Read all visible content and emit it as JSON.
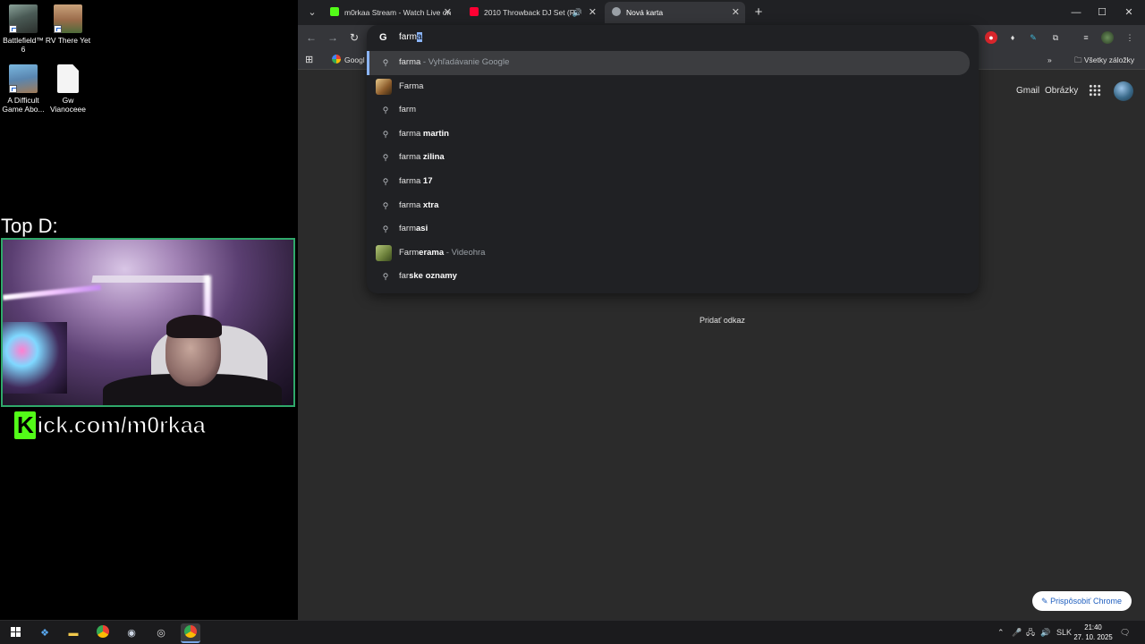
{
  "desktop": {
    "icons": [
      {
        "label": "Battlefield™ 6"
      },
      {
        "label": "RV There Yet"
      },
      {
        "label": "A Difficult Game Abo..."
      },
      {
        "label": "Gw Vianoceee"
      }
    ],
    "overlay_title": "Top D:",
    "kick_k": "K",
    "kick_text": "ick.com/m0rkaa"
  },
  "tabs": [
    {
      "title": "m0rkaa Stream - Watch Live on",
      "favicon_color": "#53fc18"
    },
    {
      "title": "2010 Throwback DJ Set (Ri",
      "favicon_color": "#ff0033"
    },
    {
      "title": "Nová karta",
      "active": true
    }
  ],
  "omnibox": {
    "typed": "farm",
    "autocompleted": "a",
    "suggestions": [
      {
        "typed": "farma",
        "bold": "",
        "desc": " - Vyhľadávanie Google",
        "icon": "search-icon"
      },
      {
        "typed": "Farma",
        "bold": "",
        "desc": "",
        "icon": "image-thumbnail"
      },
      {
        "typed": "farm",
        "bold": "",
        "desc": "",
        "icon": "search-icon"
      },
      {
        "typed": "farma",
        "bold": " martin",
        "desc": "",
        "icon": "search-icon"
      },
      {
        "typed": "farma",
        "bold": " zilina",
        "desc": "",
        "icon": "search-icon"
      },
      {
        "typed": "farma",
        "bold": " 17",
        "desc": "",
        "icon": "search-icon"
      },
      {
        "typed": "farma",
        "bold": " xtra",
        "desc": "",
        "icon": "search-icon"
      },
      {
        "typed": "farm",
        "bold": "asi",
        "desc": "",
        "icon": "search-icon"
      },
      {
        "typed": "Farm",
        "bold": "erama",
        "desc": " - Videohra",
        "icon": "image-thumbnail"
      },
      {
        "typed": "far",
        "bold": "ske oznamy",
        "desc": "",
        "icon": "search-icon"
      }
    ]
  },
  "bookmarks": {
    "google": "Googl",
    "all": "Všetky záložky"
  },
  "ntp": {
    "gmail": "Gmail",
    "images": "Obrázky",
    "add_shortcut": "Pridať odkaz",
    "customize": "Prispôsobiť Chrome"
  },
  "taskbar": {
    "lang": "SLK",
    "time": "21:40",
    "date": "27. 10. 2025"
  }
}
